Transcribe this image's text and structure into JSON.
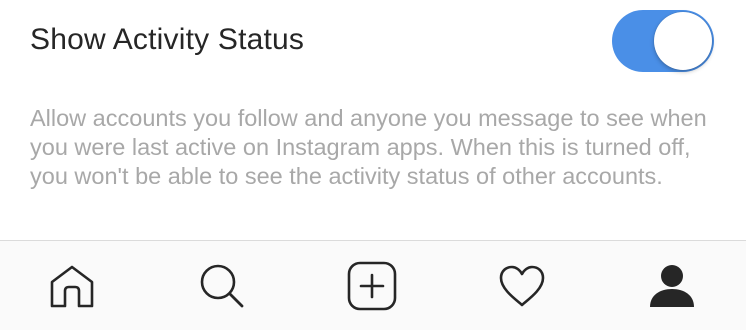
{
  "setting": {
    "title": "Show Activity Status",
    "toggle_on": true,
    "accent_color": "#4a8fe7",
    "description": "Allow accounts you follow and anyone you message to see when you were last active on Instagram apps. When this is turned off, you won't be able to see the activity status of other accounts."
  },
  "tabbar": {
    "icons": [
      "home-icon",
      "search-icon",
      "new-post-icon",
      "heart-icon",
      "profile-icon"
    ]
  }
}
